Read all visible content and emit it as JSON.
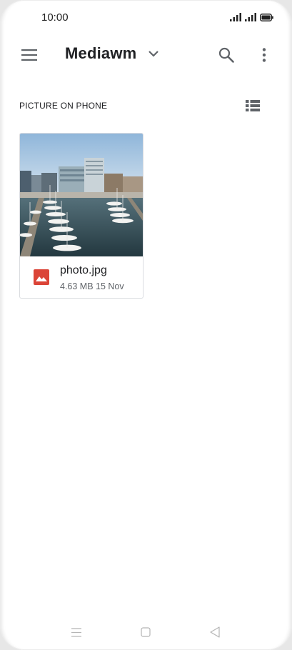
{
  "status_bar": {
    "time": "10:00",
    "icons": [
      "signal-icon",
      "signal-icon",
      "battery-icon"
    ]
  },
  "toolbar": {
    "title": "Mediawm",
    "icons": [
      "menu-icon",
      "chevron-down-icon",
      "search-icon",
      "more-vert-icon"
    ]
  },
  "section": {
    "header": "PICTURE ON PHONE",
    "view_toggle_icon": "list-view-icon"
  },
  "files": [
    {
      "name": "photo.jpg",
      "meta": "4.63 MB 15 Nov",
      "type_icon": "image-icon",
      "type_color": "#db4437"
    }
  ],
  "nav_bar": {
    "icons": [
      "recents-icon",
      "home-icon",
      "back-icon"
    ]
  },
  "colors": {
    "text_primary": "#202124",
    "text_secondary": "#5f6368",
    "icon_gray": "#5f6368",
    "image_red": "#db4437"
  }
}
